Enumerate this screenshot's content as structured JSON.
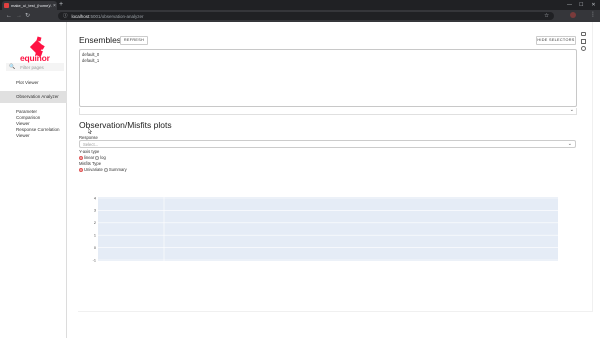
{
  "browser": {
    "tab_title": "make_ui_test_(home)/...",
    "tab_close": "×",
    "new_tab": "+",
    "url_host": "localhost",
    "url_path": ":5001/observation-analyzer",
    "min": "—",
    "max": "☐",
    "close": "✕",
    "back": "←",
    "forward": "→",
    "reload": "↻",
    "info": "ⓘ",
    "star": "☆",
    "menu": "⋮"
  },
  "sidebar": {
    "logo_text": "equinor",
    "search_placeholder": "Filter pages",
    "items": [
      {
        "label": "Plot Viewer"
      },
      {
        "label": "Observation Analyzer"
      },
      {
        "label": "Parameter Comparison Viewer"
      },
      {
        "label": "Response Correlation Viewer"
      }
    ]
  },
  "ensembles": {
    "title": "Ensembles",
    "refresh": "REFRESH",
    "hide_selectors": "HIDE SELECTORS",
    "options": [
      "default_0",
      "default_1"
    ]
  },
  "obs": {
    "title": "Observation/Misfits plots",
    "response_label": "Response",
    "select_placeholder": "Select...",
    "yaxis_label": "Y-axis type",
    "yaxis_options": [
      {
        "label": "linear",
        "selected": true
      },
      {
        "label": "log",
        "selected": false
      }
    ],
    "misfits_label": "Misfits Type",
    "misfits_options": [
      {
        "label": "Univariate",
        "selected": true
      },
      {
        "label": "Summary",
        "selected": false
      }
    ]
  },
  "chart_data": {
    "type": "scatter",
    "title": "",
    "xlabel": "",
    "ylabel": "",
    "x_ticks": [],
    "y_ticks": [
      "4",
      "3",
      "2",
      "1",
      "0",
      "-1"
    ],
    "ylim": [
      -1,
      4
    ],
    "series": [],
    "colors": {
      "plot_bg": "#e5ecf6",
      "grid": "#ffffff"
    }
  },
  "colors": {
    "brand": "#ff1243",
    "active_nav": "#e0e0e0"
  }
}
